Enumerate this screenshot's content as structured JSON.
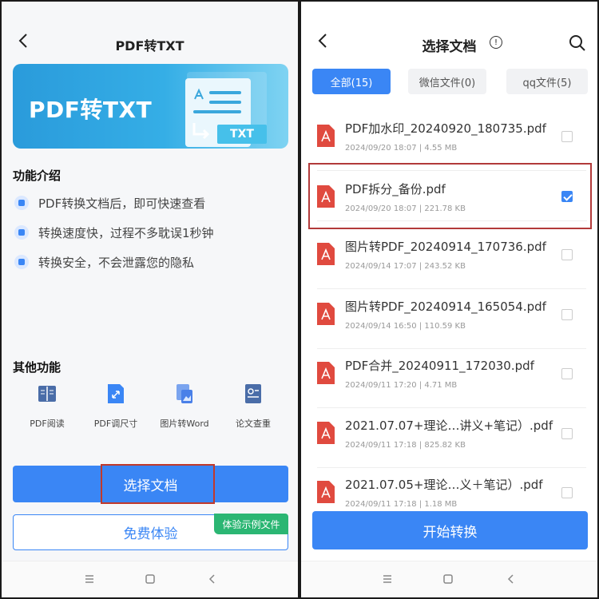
{
  "left": {
    "title": "PDF转TXT",
    "banner": {
      "text": "PDF转TXT",
      "tag": "TXT"
    },
    "features_title": "功能介绍",
    "features": [
      "PDF转换文档后，即可快速查看",
      "转换速度快，过程不多耽误1秒钟",
      "转换安全，不会泄露您的隐私"
    ],
    "other_title": "其他功能",
    "tools": [
      "PDF阅读",
      "PDF调尺寸",
      "图片转Word",
      "论文查重"
    ],
    "select_button": "选择文档",
    "trial_button": "免费体验",
    "trial_tag": "体验示例文件"
  },
  "right": {
    "title": "选择文档",
    "tabs": [
      {
        "label": "全部(15)",
        "active": true
      },
      {
        "label": "微信文件(0)",
        "active": false
      },
      {
        "label": "qq文件(5)",
        "active": false
      }
    ],
    "files": [
      {
        "name": "PDF加水印_20240920_180735.pdf",
        "meta": "2024/09/20 18:07 |   4.55 MB",
        "checked": false
      },
      {
        "name": "PDF拆分_备份.pdf",
        "meta": "2024/09/20 18:07 |   221.78 KB",
        "checked": true
      },
      {
        "name": "图片转PDF_20240914_170736.pdf",
        "meta": "2024/09/14 17:07 |   243.52 KB",
        "checked": false
      },
      {
        "name": "图片转PDF_20240914_165054.pdf",
        "meta": "2024/09/14 16:50 |   110.59 KB",
        "checked": false
      },
      {
        "name": "PDF合并_20240911_172030.pdf",
        "meta": "2024/09/11 17:20 |   4.71 MB",
        "checked": false
      },
      {
        "name": "2021.07.07+理论…讲义+笔记）.pdf",
        "meta": "2024/09/11 17:18 |   825.82 KB",
        "checked": false
      },
      {
        "name": "2021.07.05+理论…义＋笔记）.pdf",
        "meta": "2024/09/11 17:18 |   1.18 MB",
        "checked": false
      }
    ],
    "start_button": "开始转换"
  },
  "colors": {
    "accent": "#3a86f5",
    "highlight": "#c0392b",
    "pdf_red": "#e04a3f",
    "green": "#2bb673"
  }
}
